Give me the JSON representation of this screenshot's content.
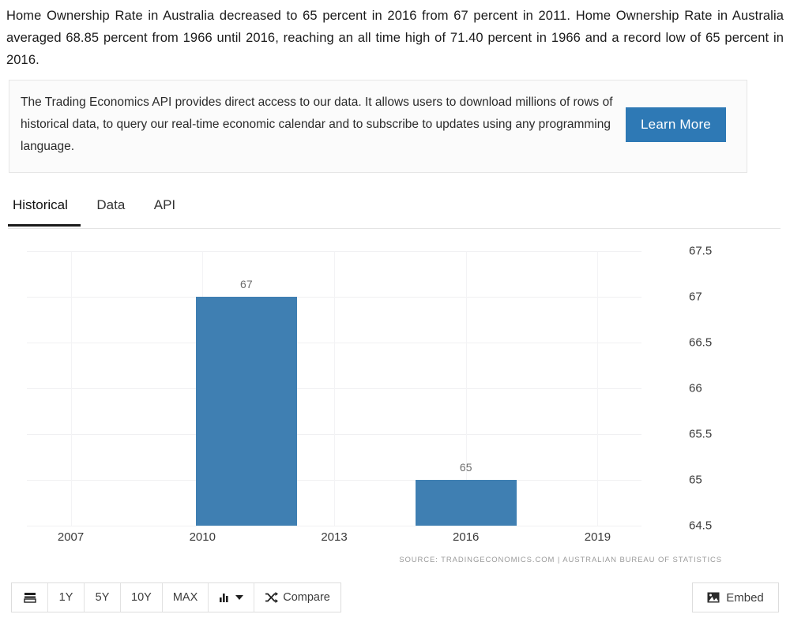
{
  "intro": {
    "paragraph": "Home Ownership Rate in Australia decreased to 65 percent in 2016 from 67 percent in 2011. Home Ownership Rate in Australia averaged 68.85 percent from 1966 until 2016, reaching an all time high of 71.40 percent in 1966 and a record low of 65 percent in 2016."
  },
  "promo": {
    "text": "The Trading Economics API provides direct access to our data. It allows users to download millions of rows of historical data, to query our real-time economic calendar and to subscribe to updates using any programming language.",
    "button_label": "Learn More",
    "button_color": "#2e79b5"
  },
  "tabs": [
    {
      "label": "Historical",
      "active": true
    },
    {
      "label": "Data",
      "active": false
    },
    {
      "label": "API",
      "active": false
    }
  ],
  "chart_data": {
    "type": "bar",
    "title": "",
    "subtitle": "",
    "xlabel": "",
    "ylabel": "",
    "categories": [
      "2011",
      "2016"
    ],
    "values": [
      67,
      65
    ],
    "data_labels": [
      "67",
      "65"
    ],
    "bar_color": "#3f7fb2",
    "ylim": [
      64.5,
      67.5
    ],
    "yticks": [
      "67.5",
      "67",
      "66.5",
      "66",
      "65.5",
      "65",
      "64.5"
    ],
    "ytick_values": [
      67.5,
      67,
      66.5,
      66,
      65.5,
      65,
      64.5
    ],
    "ytick_position": "right",
    "xlim": [
      2006,
      2020
    ],
    "xticks": [
      "2007",
      "2010",
      "2013",
      "2016",
      "2019"
    ],
    "xtick_values": [
      2007,
      2010,
      2013,
      2016,
      2019
    ],
    "grid": true,
    "legend": "none",
    "source_note": "SOURCE: TRADINGECONOMICS.COM | AUSTRALIAN BUREAU OF STATISTICS"
  },
  "toolbar": {
    "range_buttons": [
      "1Y",
      "5Y",
      "10Y",
      "MAX"
    ],
    "compare_label": "Compare",
    "embed_label": "Embed"
  }
}
